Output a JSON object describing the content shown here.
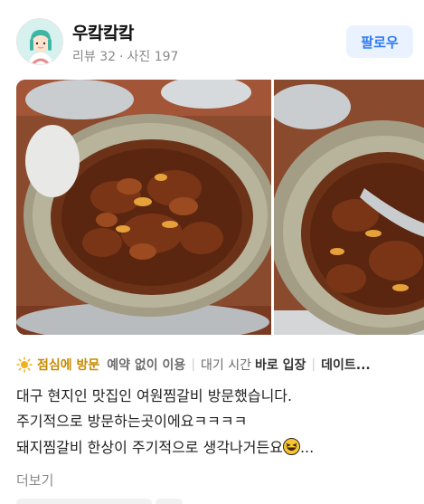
{
  "profile": {
    "name": "우캌캌캌",
    "reviews_label": "리뷰 32",
    "photos_label": "사진 197",
    "follow_label": "팔로우"
  },
  "photos": [
    {
      "icon": "braised-galbi-photo"
    },
    {
      "icon": "braised-galbi-photo-2"
    }
  ],
  "tags": {
    "main": "점심에 방문",
    "reservation": "예약 없이 이용",
    "wait_label": "대기 시간",
    "wait_value": "바로 입장",
    "purpose": "데이트..."
  },
  "review": {
    "lines": [
      "대구 현지인 맛집인 여원찜갈비 방문했습니다.",
      "주기적으로 방문하는곳이에요ㅋㅋㅋㅋ",
      "돼지찜갈비 한상이 주기적으로 생각나거든요"
    ],
    "ellipsis": "...",
    "emoji": "laughing-face-emoji"
  },
  "more_label": "더보기",
  "colors": {
    "follow_bg": "#eaf2ff",
    "follow_text": "#2f7bf5",
    "tag_accent": "#c78a00"
  }
}
